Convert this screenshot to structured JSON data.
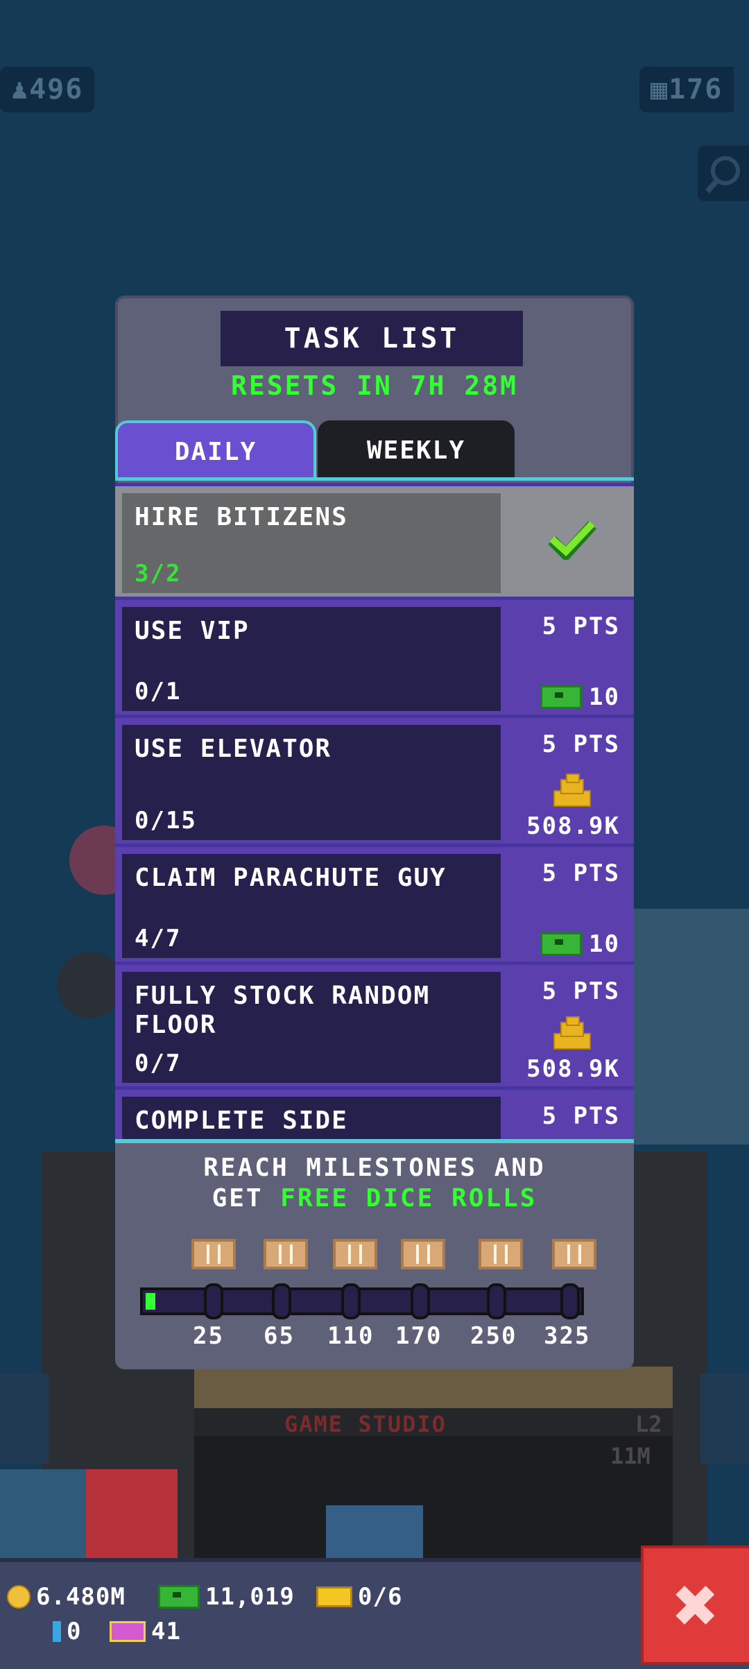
{
  "hud": {
    "population": "496",
    "floors": "176"
  },
  "dialog": {
    "title": "TASK LIST",
    "reset_text": "RESETS IN 7H 28M",
    "tabs": [
      {
        "label": "DAILY",
        "active": true
      },
      {
        "label": "WEEKLY",
        "active": false
      }
    ],
    "tasks": [
      {
        "name": "HIRE BITIZENS",
        "progress": "3/2",
        "completed": true
      },
      {
        "name": "USE VIP",
        "progress": "0/1",
        "points": "5 PTS",
        "reward": "10",
        "reward_icon": "bux-icon"
      },
      {
        "name": "USE ELEVATOR",
        "progress": "0/15",
        "points": "5 PTS",
        "reward": "508.9K",
        "reward_icon": "coins-icon"
      },
      {
        "name": "CLAIM PARACHUTE GUY",
        "progress": "4/7",
        "points": "5 PTS",
        "reward": "10",
        "reward_icon": "bux-icon"
      },
      {
        "name": "FULLY STOCK RANDOM FLOOR",
        "progress": "0/7",
        "points": "5 PTS",
        "reward": "508.9K",
        "reward_icon": "coins-icon"
      },
      {
        "name": "COMPLETE SIDE",
        "points": "5 PTS"
      }
    ],
    "milestones": {
      "line1": "REACH MILESTONES AND",
      "line2_prefix": "GET",
      "line2_highlight": "FREE DICE ROLLS",
      "values": [
        "25",
        "65",
        "110",
        "170",
        "250",
        "325"
      ],
      "progress_fraction": 0.02
    }
  },
  "scene": {
    "floor_name": "GAME STUDIO",
    "floor_level": "L2",
    "floor_value": "11M"
  },
  "bottombar": {
    "coins": "6.480M",
    "bux": "11,019",
    "tickets": "0/6",
    "blue_count": "0",
    "vip_count": "41",
    "close_symbol": "✖"
  },
  "colors": {
    "background": "#153a55",
    "accent_green": "#33ff33",
    "tab_active": "#6a4fd0",
    "task_panel": "#25204c",
    "close_red": "#e03b3b"
  }
}
